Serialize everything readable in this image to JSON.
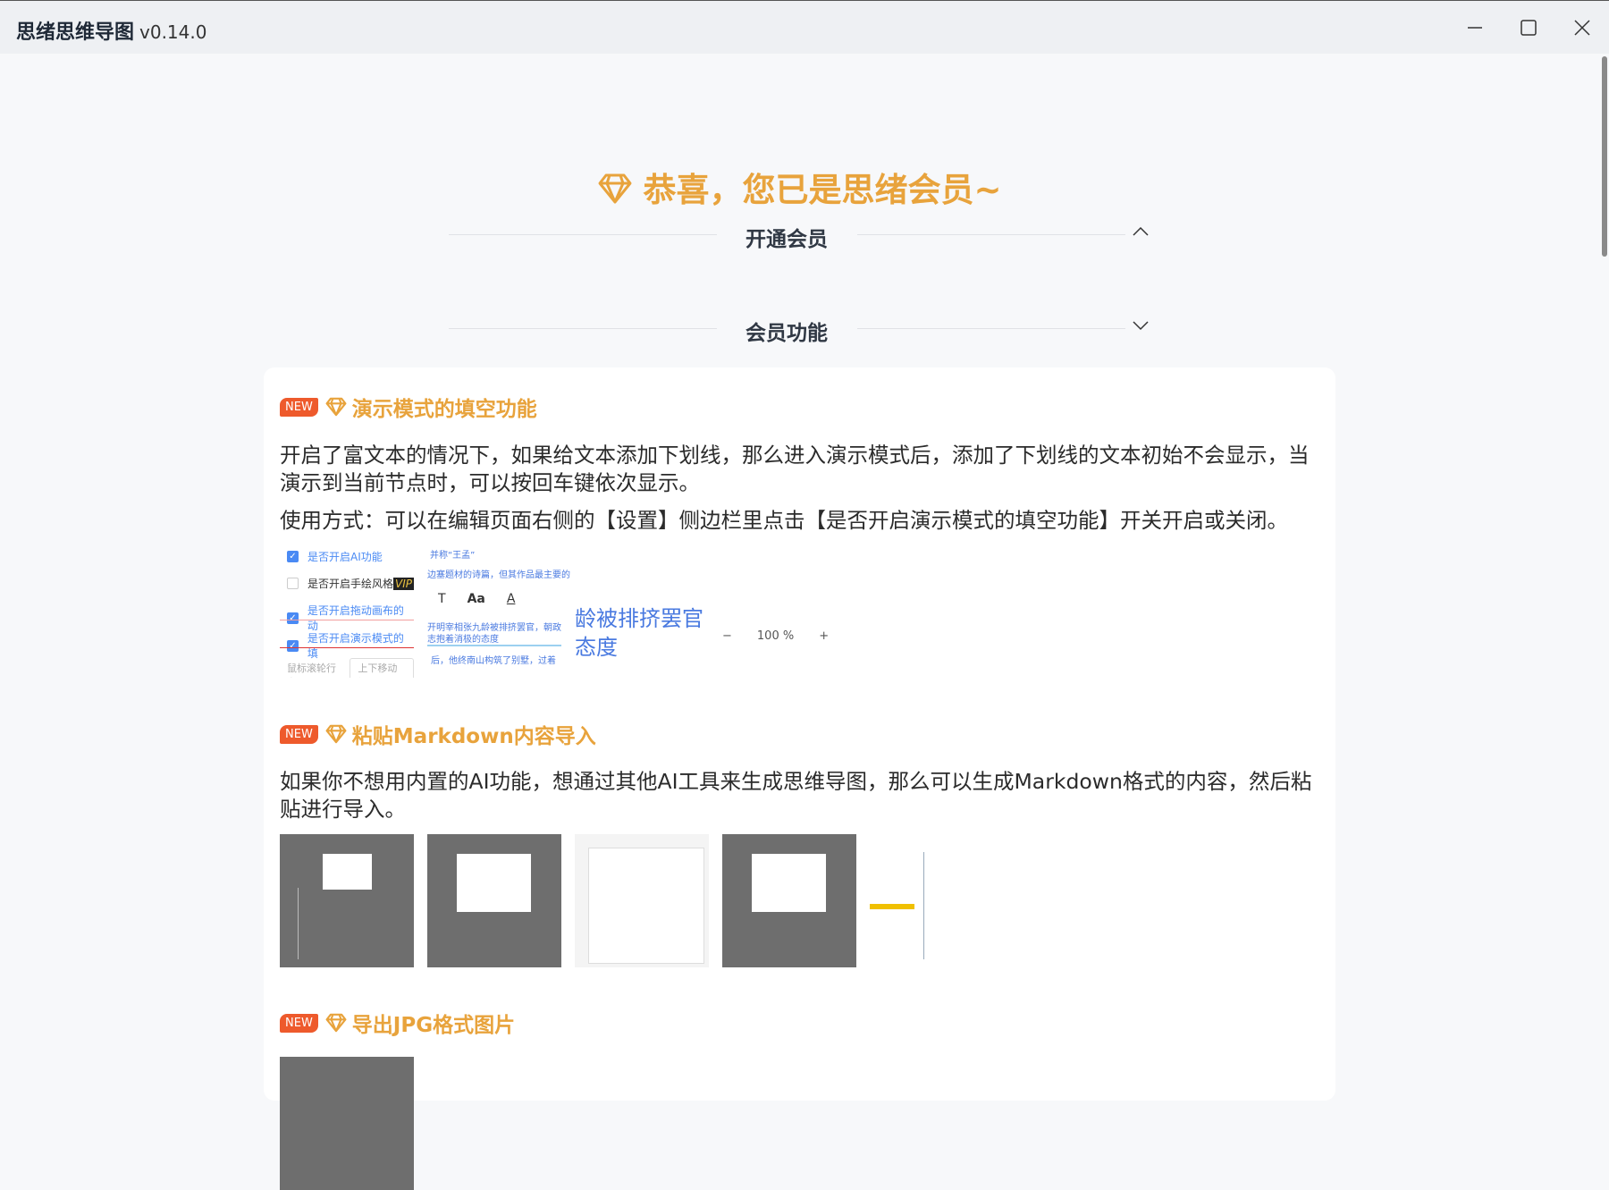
{
  "window": {
    "title": "思绪思维导图",
    "version": "v0.14.0"
  },
  "hero": {
    "text": "恭喜，您已是思绪会员~",
    "icon": "diamond-icon"
  },
  "sections": {
    "open_member": "开通会员",
    "member_features": "会员功能"
  },
  "colors": {
    "accent": "#e8a33c",
    "badge": "#ee5a2c"
  },
  "features": [
    {
      "badge": "NEW",
      "title": "演示模式的填空功能",
      "desc": "开启了富文本的情况下，如果给文本添加下划线，那么进入演示模式后，添加了下划线的文本初始不会显示，当演示到当前节点时，可以按回车键依次显示。",
      "usage": "使用方式：可以在编辑页面右侧的【设置】侧边栏里点击【是否开启演示模式的填空功能】开关开启或关闭。",
      "shot": {
        "settings": [
          "是否开启AI功能",
          "是否开启手绘风格",
          "是否开启拖动画布的动",
          "是否开启演示模式的填"
        ],
        "vip": "VIP",
        "wheel_label": "鼠标滚轮行为",
        "wheel_value": "上下移动视",
        "quote": "并称“王孟”",
        "text1": "边塞题材的诗篇，但其作品最主要的",
        "text2": "开明宰相张九龄被排挤罢官，朝政",
        "text3": "志抱着消极的态度",
        "text4": "后，他终南山构筑了别墅，过着",
        "toolbar": [
          "T",
          "Aa",
          "A"
        ],
        "big1": "龄被排挤罢官",
        "big2": "态度",
        "zoom": "100 %",
        "minus": "−",
        "plus": "+"
      }
    },
    {
      "badge": "NEW",
      "title": "粘贴Markdown内容导入",
      "desc": "如果你不想用内置的AI功能，想通过其他AI工具来生成思维导图，那么可以生成Markdown格式的内容，然后粘贴进行导入。"
    },
    {
      "badge": "NEW",
      "title": "导出JPG格式图片"
    }
  ]
}
